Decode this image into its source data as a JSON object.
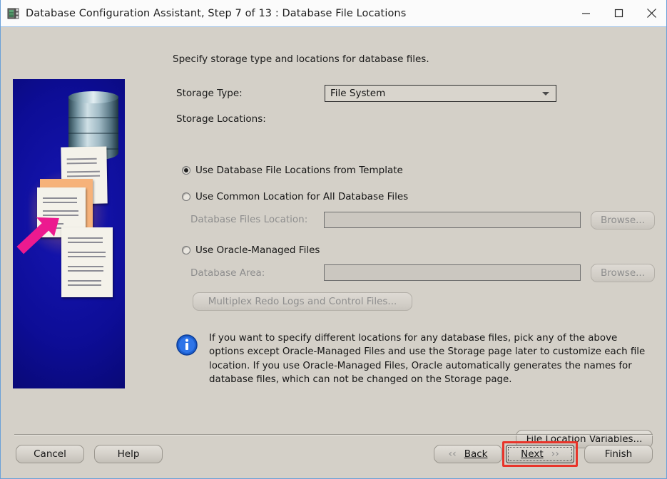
{
  "window": {
    "title": "Database Configuration Assistant, Step 7 of 13 : Database File Locations",
    "icon": "database-app-icon",
    "controls": {
      "minimize": "minimize-icon",
      "maximize": "maximize-icon",
      "close": "close-icon"
    }
  },
  "theme": {
    "window_bg": "#d4d0c8",
    "titlebar_bg": "#fbfbfb",
    "window_border": "#6aa0d8",
    "highlight": "#e8342a",
    "info_blue": "#1c5fd0",
    "art_blue": "#0a0a8c",
    "art_arrow": "#ec1a8f"
  },
  "main": {
    "intro": "Specify storage type and locations for database files.",
    "storage_type": {
      "label": "Storage Type:",
      "value": "File System",
      "caret": "chevron-down-icon"
    },
    "storage_locations_label": "Storage Locations:",
    "options": [
      {
        "id": "template",
        "label": "Use Database File Locations from Template",
        "selected": true
      },
      {
        "id": "common",
        "label": "Use Common Location for All Database Files",
        "selected": false
      },
      {
        "id": "omf",
        "label": "Use Oracle-Managed Files",
        "selected": false
      }
    ],
    "files_location": {
      "label": "Database Files Location:",
      "value": "",
      "placeholder": "",
      "enabled": false,
      "browse_label": "Browse..."
    },
    "database_area": {
      "label": "Database Area:",
      "value": "",
      "placeholder": "",
      "enabled": false,
      "browse_label": "Browse..."
    },
    "multiplex_label": "Multiplex Redo Logs and Control Files...",
    "info": {
      "icon": "info-icon",
      "text": "If you want to specify different locations for any database files, pick any of the above options except Oracle-Managed Files and use the Storage page later to customize each file location. If you use Oracle-Managed Files, Oracle automatically generates the names for database files, which can not be changed on the Storage page."
    },
    "file_location_variables_label": "File Location Variables..."
  },
  "footer": {
    "cancel": "Cancel",
    "help": "Help",
    "back": "Back",
    "next": "Next",
    "finish": "Finish",
    "back_chevron": "chevron-left-icon",
    "next_chevron": "chevron-right-icon"
  },
  "artwork": {
    "name": "database-files-illustration",
    "description": "Blue gradient panel with a database cylinder, stacked document pages and a magenta arrow"
  }
}
